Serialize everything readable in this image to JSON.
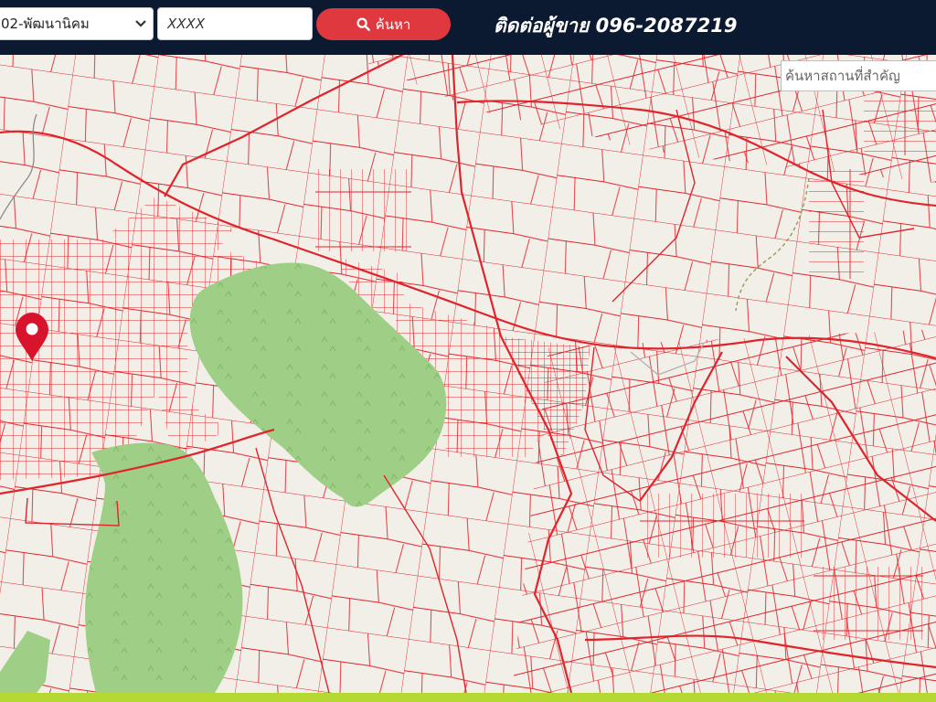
{
  "header": {
    "district_value": "02-พัฒนานิคม",
    "parcel_value": "XXXX",
    "search_label": "ค้นหา",
    "search_icon": "search-icon",
    "contact_text": "ติดต่อผู้ขาย 096-2087219"
  },
  "map": {
    "place_search_placeholder": "ค้นหาสถานที่สำคัญ",
    "marker_icon": "map-pin-icon",
    "colors": {
      "background": "#f2efe9",
      "parcel_lines": "#e0242c",
      "forest": "#9fcf86",
      "marker": "#d7142c",
      "header": "#0b1a30",
      "search_button": "#e0383f",
      "bottom_strip": "#b6d832"
    }
  }
}
